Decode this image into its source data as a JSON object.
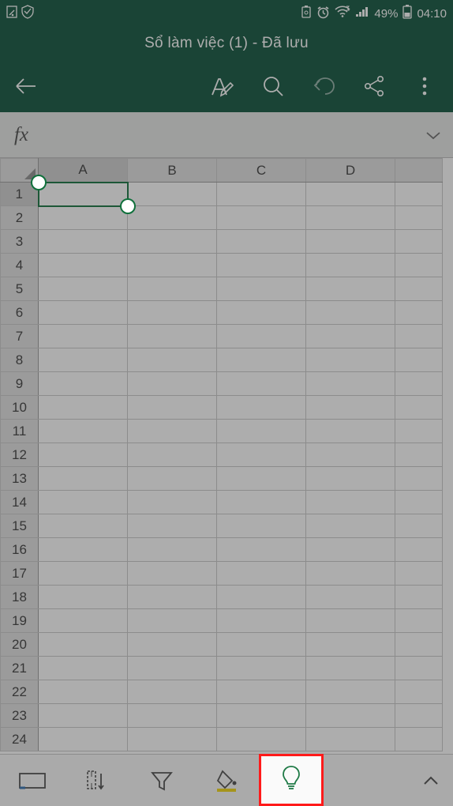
{
  "statusbar": {
    "battery_pct": "49%",
    "time": "04:10"
  },
  "header": {
    "title": "Sổ làm việc (1) - Đã lưu"
  },
  "formulabar": {
    "label": "fx",
    "value": ""
  },
  "sheet": {
    "columns": [
      "A",
      "B",
      "C",
      "D"
    ],
    "rows": [
      "1",
      "2",
      "3",
      "4",
      "5",
      "6",
      "7",
      "8",
      "9",
      "10",
      "11",
      "12",
      "13",
      "14",
      "15",
      "16",
      "17",
      "18",
      "19",
      "20",
      "21",
      "22",
      "23",
      "24"
    ],
    "selected_cell": "A1"
  }
}
